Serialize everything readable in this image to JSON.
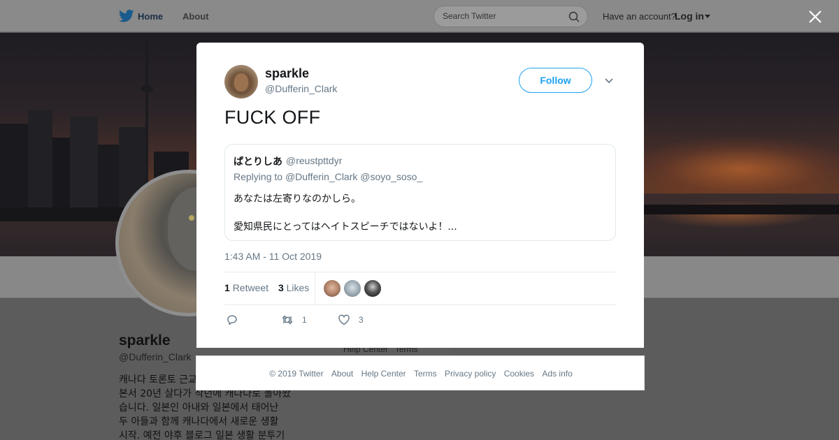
{
  "topbar": {
    "home_label": "Home",
    "about_label": "About",
    "search_placeholder": "Search Twitter",
    "have_account": "Have an account?",
    "login_label": "Log in"
  },
  "profile": {
    "name": "sparkle",
    "handle": "@Dufferin_Clark",
    "bio": "캐나다 토론토 근교 ...\n본서 20년 살다가 작년에 캐나다로 돌아왔\n습니다. 일본인 아내와 일본에서 태어난\n두 아들과 함께 캐나다에서 새로운 생활\n시작. 예전 야후 블로그 일본 생활 분투기",
    "side_links": "Help Center   Terms"
  },
  "tweet": {
    "author_name": "sparkle",
    "author_handle": "@Dufferin_Clark",
    "follow_label": "Follow",
    "text": "FUCK OFF",
    "quote": {
      "name": "ぱとりしあ",
      "handle": "@reustpttdyr",
      "reply_prefix": "Replying to",
      "reply_mentions": "@Dufferin_Clark @soyo_soso_",
      "line1": "あなたは左寄りなのかしら。",
      "line2": "愛知県民にとってはヘイトスピーチではないよ！..."
    },
    "timestamp": "1:43 AM - 11 Oct 2019",
    "retweet_count": "1",
    "retweet_label": "Retweet",
    "like_count": "3",
    "like_label": "Likes",
    "action_retweet_count": "1",
    "action_like_count": "3"
  },
  "footer": {
    "copyright": "© 2019 Twitter",
    "about": "About",
    "help": "Help Center",
    "terms": "Terms",
    "privacy": "Privacy policy",
    "cookies": "Cookies",
    "ads": "Ads info"
  },
  "colors": {
    "accent": "#1da1f2",
    "secondary_text": "#657786",
    "overlay": "#5a5a5a"
  },
  "icons": [
    "twitter-bird-icon",
    "search-icon",
    "close-icon",
    "chevron-down-icon",
    "reply-icon",
    "retweet-icon",
    "heart-icon"
  ]
}
